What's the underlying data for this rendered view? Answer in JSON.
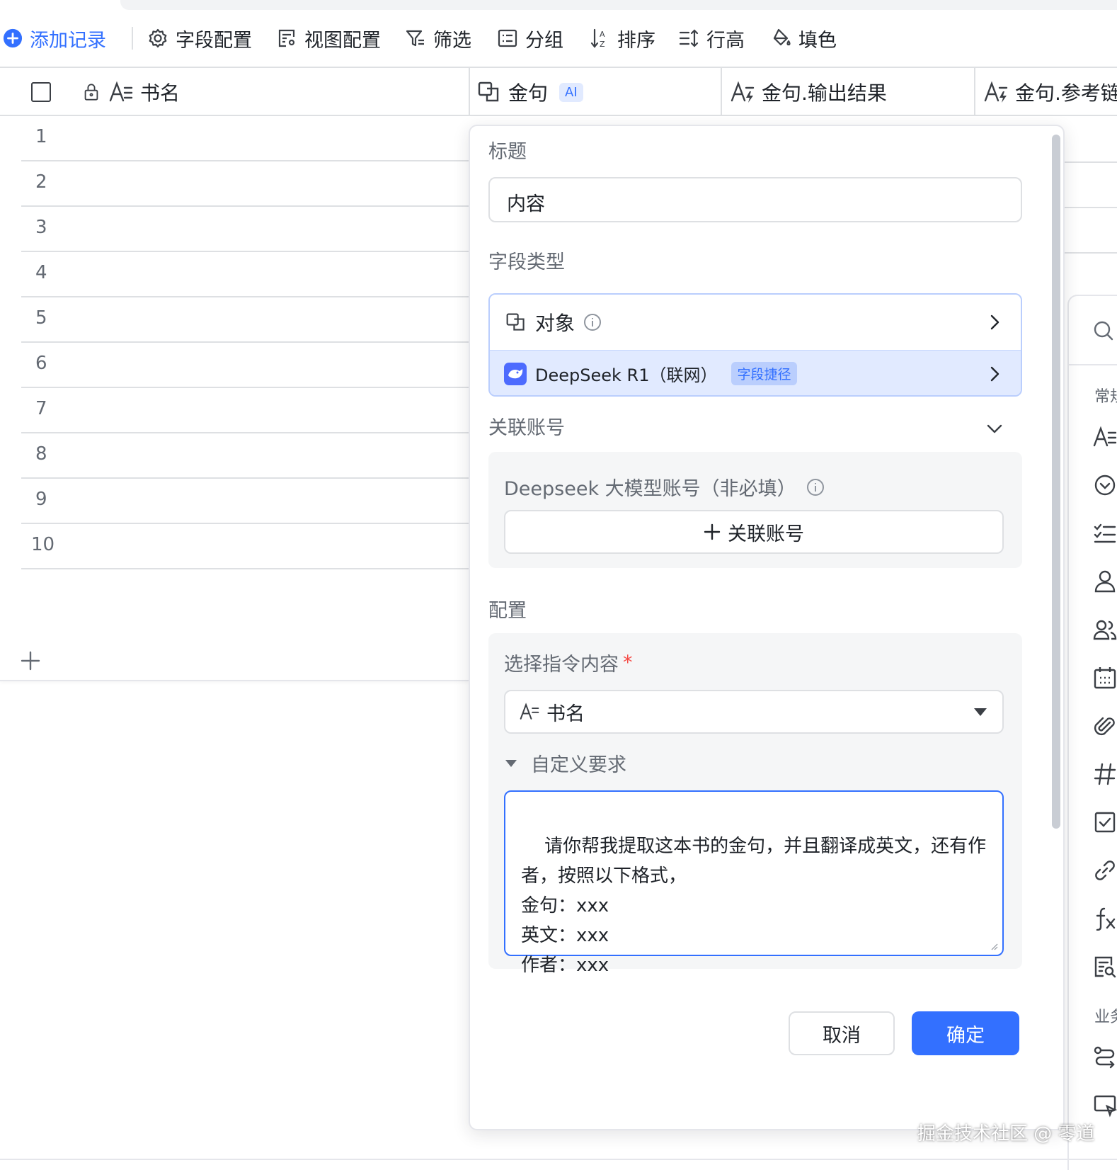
{
  "toolbar": {
    "add_record": "添加记录",
    "field_config": "字段配置",
    "view_config": "视图配置",
    "filter": "筛选",
    "group": "分组",
    "sort": "排序",
    "row_height": "行高",
    "fill_color": "填色"
  },
  "columns": {
    "book_name": "书名",
    "golden_quote": "金句",
    "ai_badge": "AI",
    "quote_output": "金句.输出结果",
    "quote_ref": "金句.参考链"
  },
  "rows": [
    "1",
    "2",
    "3",
    "4",
    "5",
    "6",
    "7",
    "8",
    "9",
    "10"
  ],
  "dialog": {
    "title_label": "标题",
    "title_value": "内容",
    "field_type_label": "字段类型",
    "field_type_value": "对象",
    "model_name": "DeepSeek R1（联网）",
    "shortcut_badge": "字段捷径",
    "linked_account_label": "关联账号",
    "account_hint": "Deepseek 大模型账号（非必填）",
    "link_account_button": "关联账号",
    "config_label": "配置",
    "select_instruction_label": "选择指令内容",
    "required_mark": "*",
    "selected_field": "书名",
    "custom_requirement_label": "自定义要求",
    "custom_requirement_text": "请你帮我提取这本书的金句，并且翻译成英文，还有作者，按照以下格式，\n金句：xxx\n英文：xxx\n作者：xxx",
    "cancel_button": "取消",
    "confirm_button": "确定"
  },
  "side_panel": {
    "common_label": "常规",
    "business_label": "业务"
  },
  "watermark": "掘金技术社区 @ 零道",
  "colors": {
    "accent": "#3370ff",
    "accent_light": "#e1eaff",
    "border": "#dee0e3",
    "text": "#1f2329",
    "muted": "#646a73"
  },
  "icons": [
    "add-circle-icon",
    "gear-icon",
    "view-config-icon",
    "filter-icon",
    "group-icon",
    "sort-icon",
    "row-height-icon",
    "fill-color-icon",
    "lock-icon",
    "text-field-icon",
    "object-field-icon",
    "ai-text-field-icon",
    "info-icon",
    "chevron-right-icon",
    "chevron-down-icon",
    "deepseek-logo-icon",
    "plus-icon",
    "search-icon"
  ]
}
